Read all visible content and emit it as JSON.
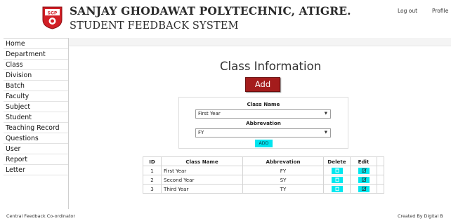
{
  "header": {
    "org_title": "SANJAY GHODAWAT POLYTECHNIC, ATIGRE.",
    "system_title": "STUDENT FEEDBACK SYSTEM",
    "logo_text": "SGP",
    "logout_label": "Log out",
    "profile_label": "Profile"
  },
  "sidebar": {
    "items": [
      {
        "label": "Home"
      },
      {
        "label": "Department"
      },
      {
        "label": "Class"
      },
      {
        "label": "Division"
      },
      {
        "label": "Batch"
      },
      {
        "label": "Faculty"
      },
      {
        "label": "Subject"
      },
      {
        "label": "Student"
      },
      {
        "label": "Teaching Record"
      },
      {
        "label": "Questions"
      },
      {
        "label": "User"
      },
      {
        "label": "Report"
      },
      {
        "label": "Letter"
      }
    ]
  },
  "main": {
    "title": "Class Information",
    "add_button_label": "Add",
    "form": {
      "class_name_label": "Class Name",
      "class_name_value": "First Year",
      "abbrevation_label": "Abbrevation",
      "abbrevation_value": "FY",
      "add_label": "ADD"
    },
    "table": {
      "headers": [
        "ID",
        "Class Name",
        "Abbrevation",
        "Delete",
        "Edit"
      ],
      "rows": [
        {
          "id": "1",
          "class_name": "First Year",
          "abbrevation": "FY"
        },
        {
          "id": "2",
          "class_name": "Second Year",
          "abbrevation": "SY"
        },
        {
          "id": "3",
          "class_name": "Third Year",
          "abbrevation": "TY"
        }
      ]
    }
  },
  "footer": {
    "left": "Central Feedback Co-ordinator",
    "right": "Created By Digital B"
  },
  "colors": {
    "add_button": "#a41c1c",
    "action_button": "#00e8f0",
    "logo_red": "#d21f26"
  },
  "icons": {
    "logo": "sgp-shield-logo",
    "delete": "trash-icon",
    "edit": "edit-icon",
    "dropdown": "chevron-down-icon"
  }
}
